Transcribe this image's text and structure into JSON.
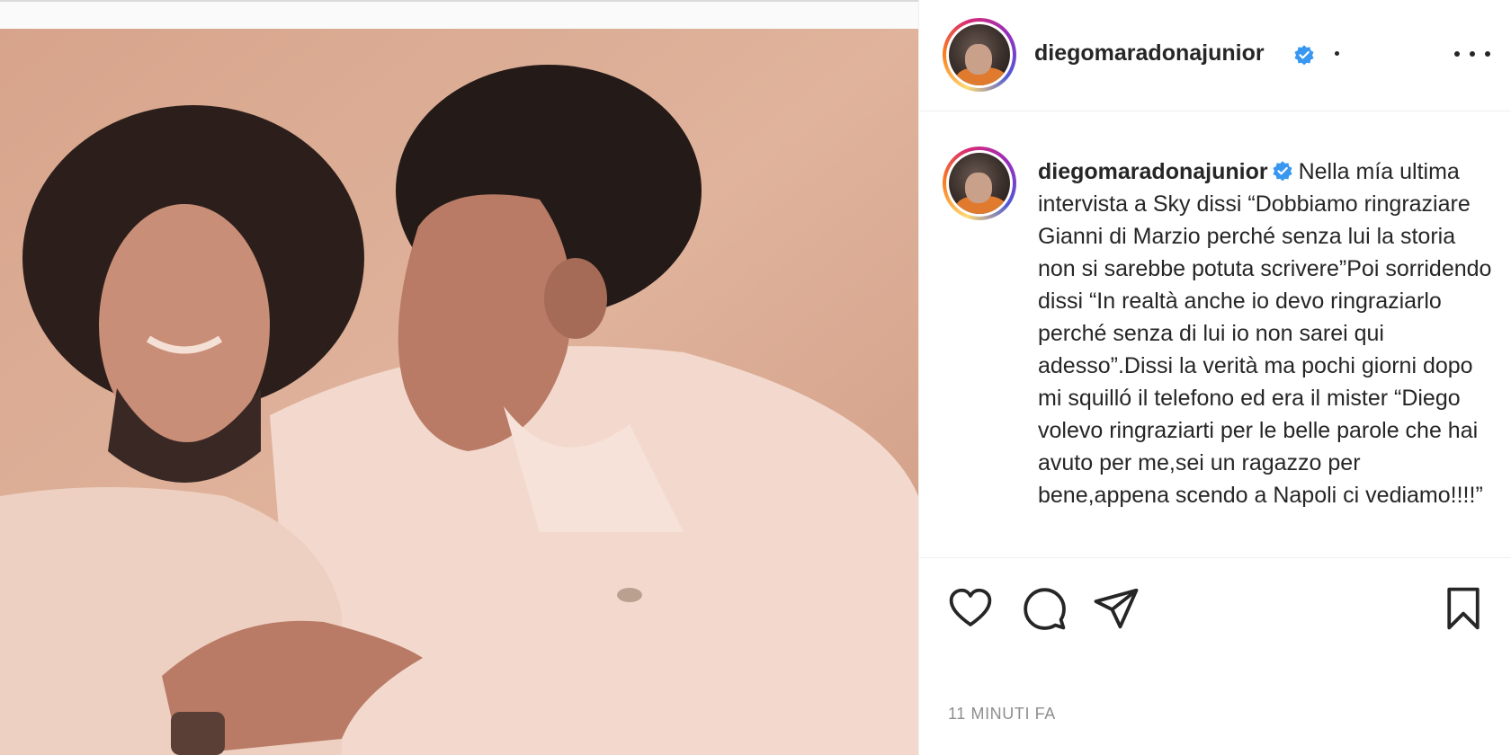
{
  "post": {
    "image_alt": "Historic sepia photo of two men, one with curly hair looking up, another leaning toward him",
    "header": {
      "username": "diegomaradonajunior",
      "follow_separator": "•"
    },
    "caption": {
      "username": "diegomaradonajunior",
      "text": "Nella mía ultima intervista a Sky dissi “Dobbiamo ringraziare Gianni di Marzio perché senza lui la storia non si sarebbe potuta scrivere”Poi sorridendo dissi “In realtà anche io devo ringraziarlo perché senza di lui io non sarei qui adesso”.Dissi la verità ma pochi giorni dopo mi squilló il telefono ed era il mister “Diego volevo ringraziarti per le belle parole che hai avuto per me,sei un ragazzo per bene,appena scendo a Napoli ci vediamo!!!!”"
    },
    "actions": {
      "like_icon": "heart-icon",
      "comment_icon": "comment-icon",
      "share_icon": "paper-plane-icon",
      "save_icon": "bookmark-icon"
    },
    "timestamp": "11 minuti fa"
  },
  "colors": {
    "verified_badge": "#3897f0",
    "text_primary": "#262626",
    "text_secondary": "#8e8e8e",
    "divider": "#efefef",
    "photo_tone": "#d9a88e"
  }
}
